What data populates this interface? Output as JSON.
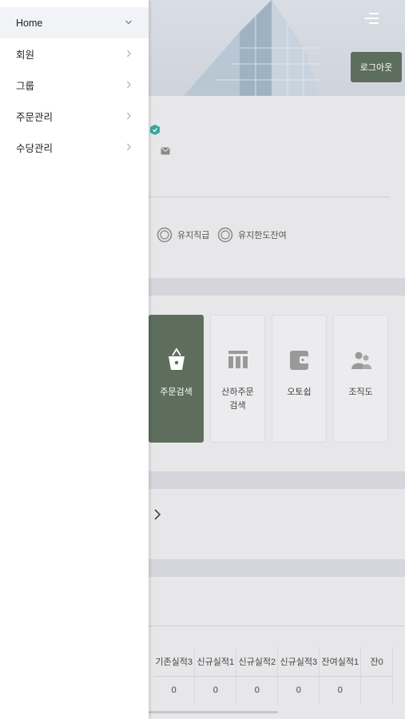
{
  "drawer": {
    "items": [
      {
        "label": "Home",
        "expanded": true
      },
      {
        "label": "회원",
        "expanded": false
      },
      {
        "label": "그룹",
        "expanded": false
      },
      {
        "label": "주문관리",
        "expanded": false
      },
      {
        "label": "수당관리",
        "expanded": false
      }
    ]
  },
  "header": {
    "logout_label": "로그아웃",
    "icons": [
      "menu-icon",
      "user-icon"
    ]
  },
  "stats": [
    {
      "label": "유지직급",
      "icon": "ring-icon"
    },
    {
      "label": "유지한도잔여",
      "icon": "ring-icon"
    }
  ],
  "tiles": [
    {
      "label": "주문검색",
      "icon": "shopping-bag-icon",
      "active": true
    },
    {
      "label": "산하주문\n검색",
      "icon": "table-icon",
      "active": false
    },
    {
      "label": "오토쉽",
      "icon": "wallet-icon",
      "active": false
    },
    {
      "label": "조직도",
      "icon": "people-icon",
      "active": false
    }
  ],
  "table": {
    "headers": [
      "기존실적3",
      "신규실적1",
      "신규실적2",
      "신규실적3",
      "잔여실적1",
      "잔0"
    ],
    "row": [
      "0",
      "0",
      "0",
      "0",
      "0",
      ""
    ]
  },
  "colors": {
    "accent": "#5d6e5c",
    "drawer_active_bg": "#f2f3f7",
    "badge": "#3aa59a"
  }
}
